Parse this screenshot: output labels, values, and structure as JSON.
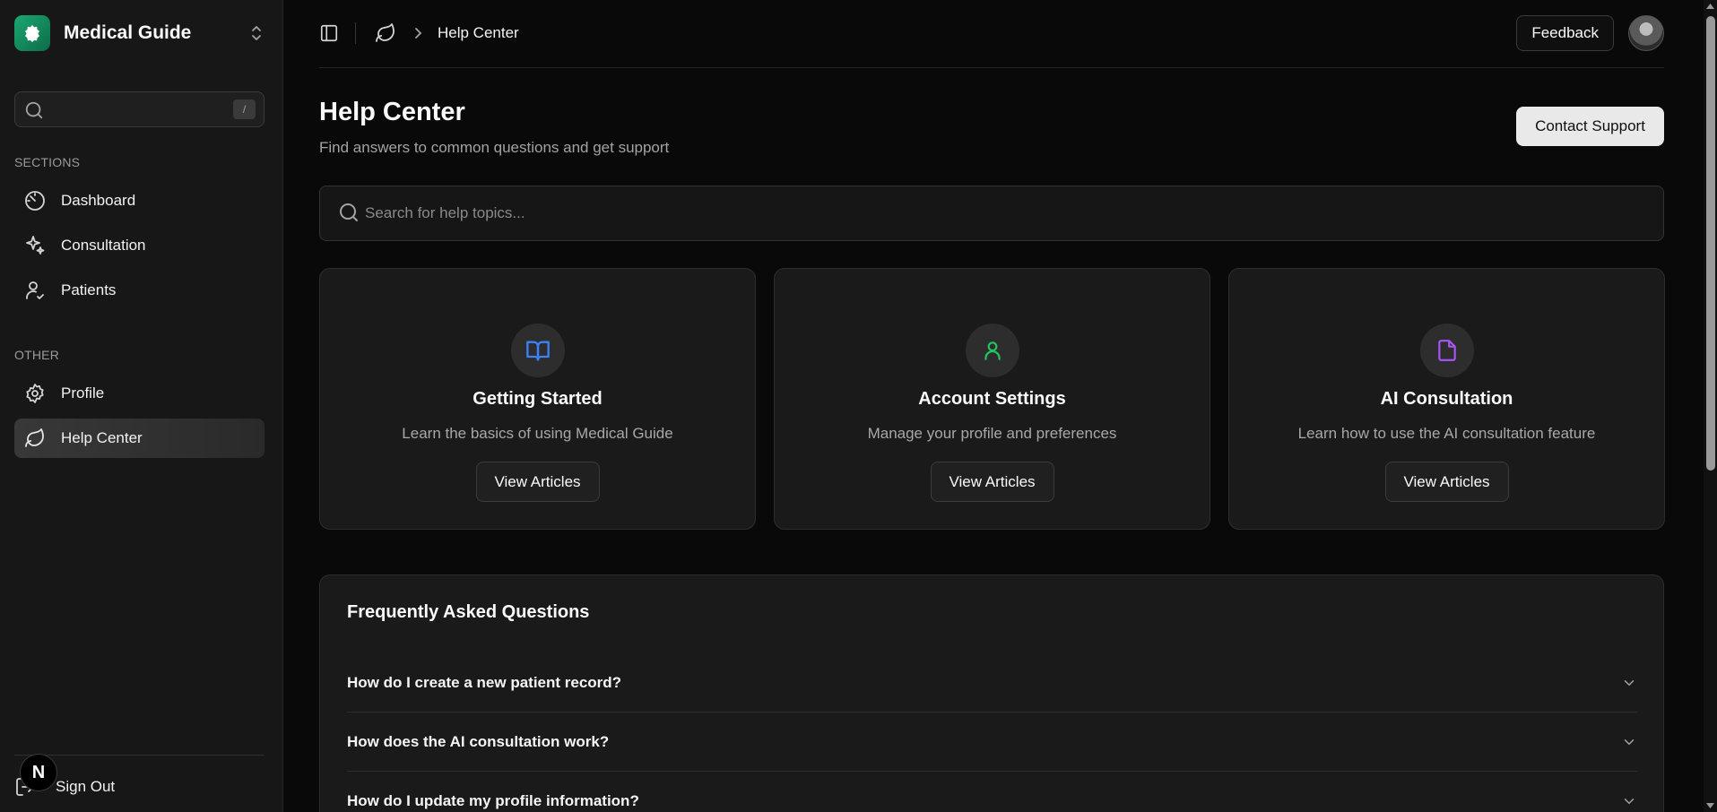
{
  "brand": {
    "name": "Medical Guide",
    "logo_color": "#1aa872"
  },
  "sidebar": {
    "search": {
      "value": "",
      "placeholder": "",
      "shortcut": "/"
    },
    "sections_label": "SECTIONS",
    "sections": [
      {
        "label": "Dashboard",
        "icon": "gauge-icon"
      },
      {
        "label": "Consultation",
        "icon": "sparkles-icon"
      },
      {
        "label": "Patients",
        "icon": "user-check-icon"
      }
    ],
    "other_label": "OTHER",
    "other": [
      {
        "label": "Profile",
        "icon": "gear-icon"
      },
      {
        "label": "Help Center",
        "icon": "leaf-icon",
        "active": true
      }
    ],
    "sign_out": "Sign Out",
    "badge_letter": "N"
  },
  "topbar": {
    "breadcrumb": "Help Center",
    "feedback_label": "Feedback"
  },
  "main": {
    "title": "Help Center",
    "subtitle": "Find answers to common questions and get support",
    "contact_label": "Contact Support",
    "search_placeholder": "Search for help topics...",
    "cards": [
      {
        "title": "Getting Started",
        "desc": "Learn the basics of using Medical Guide",
        "button": "View Articles",
        "icon": "book-open-icon",
        "icon_color": "#3b82f6"
      },
      {
        "title": "Account Settings",
        "desc": "Manage your profile and preferences",
        "button": "View Articles",
        "icon": "user-icon",
        "icon_color": "#22c55e"
      },
      {
        "title": "AI Consultation",
        "desc": "Learn how to use the AI consultation feature",
        "button": "View Articles",
        "icon": "file-icon",
        "icon_color": "#a855f7"
      }
    ],
    "faq": {
      "title": "Frequently Asked Questions",
      "items": [
        "How do I create a new patient record?",
        "How does the AI consultation work?",
        "How do I update my profile information?"
      ]
    }
  }
}
